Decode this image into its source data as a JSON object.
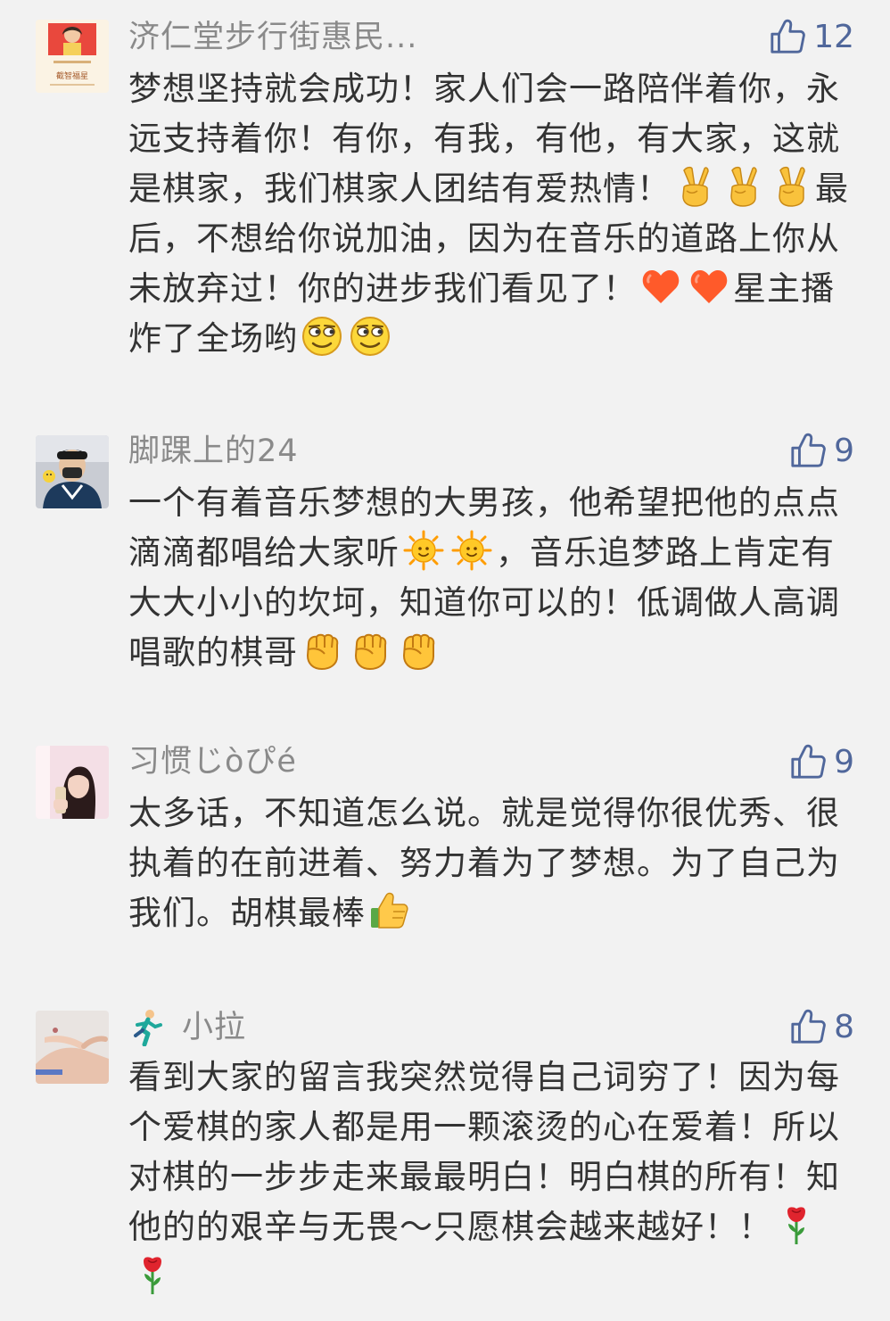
{
  "comments": [
    {
      "author": "济仁堂步行街惠民...",
      "likes": "12",
      "avatar_text": "截智福星",
      "segments": [
        "梦想坚持就会成功！家人们会一路陪伴着你，永远支持着你！有你，有我，有他，有大家，这就是棋家，我们棋家人团结有爱热情！",
        "最后，不想给你说加油，因为在音乐的道路上你从未放弃过！你的进步我们看见了！",
        "星主播炸了全场哟"
      ]
    },
    {
      "author": "脚踝上的24",
      "likes": "9",
      "segments": [
        "一个有着音乐梦想的大男孩，他希望把他的点点滴滴都唱给大家听",
        "，音乐追梦路上肯定有大大小小的坎坷，知道你可以的！低调做人高调唱歌的棋哥"
      ]
    },
    {
      "author": "习惯じòぴé",
      "likes": "9",
      "segments": [
        "太多话，不知道怎么说。就是觉得你很优秀、很执着的在前进着、努力着为了梦想。为了自己为我们。胡棋最棒"
      ]
    },
    {
      "author": "小拉",
      "likes": "8",
      "segments": [
        "看到大家的留言我突然觉得自己词穷了！因为每个爱棋的家人都是用一颗滚烫的心在爱着！所以对棋的一步步走来最最明白！明白棋的所有！知他的的艰辛与无畏～只愿棋会越来越好！！"
      ]
    }
  ],
  "colors": {
    "background": "#f2f2f2",
    "author": "#8a8a8a",
    "content": "#333333",
    "like_accent": "#50679b"
  },
  "icons": [
    "thumbs-up-icon",
    "victory-hand-emoji",
    "heart-emoji",
    "smirk-face-emoji",
    "sun-emoji",
    "fist-emoji",
    "thumbs-up-emoji",
    "runner-emoji",
    "rose-emoji"
  ]
}
